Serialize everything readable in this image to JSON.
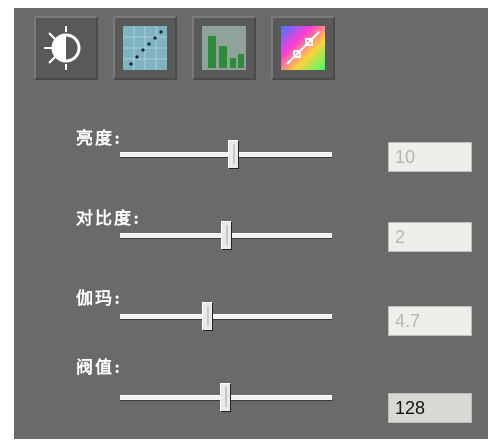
{
  "toolbar": {
    "buttons": [
      {
        "name": "brightness-tool",
        "icon": "brightness-icon"
      },
      {
        "name": "curve-tool",
        "icon": "curve-grid-icon"
      },
      {
        "name": "histogram-tool",
        "icon": "histogram-icon"
      },
      {
        "name": "color-curve-tool",
        "icon": "color-gradient-curve-icon"
      }
    ]
  },
  "controls": [
    {
      "label": "亮度:",
      "value": "10",
      "enabled": false
    },
    {
      "label": "对比度:",
      "value": "2",
      "enabled": false
    },
    {
      "label": "伽玛:",
      "value": "4.7",
      "enabled": false
    },
    {
      "label": "阀值:",
      "value": "128",
      "enabled": true
    }
  ],
  "colors": {
    "panel": "#6a6a6a",
    "field_disabled_text": "#b7b7b0",
    "field_active_bg": "#d9d9d4"
  }
}
